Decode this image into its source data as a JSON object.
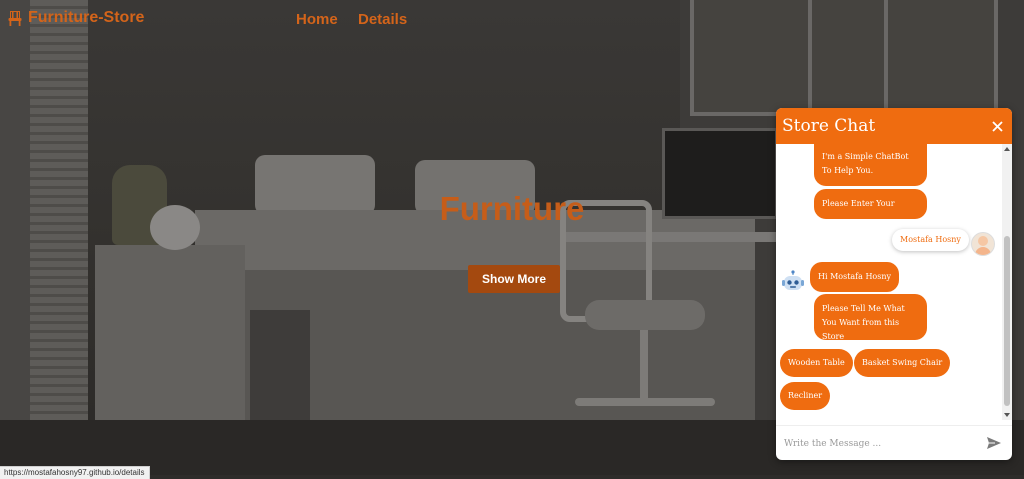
{
  "navbar": {
    "brand": "Furniture-Store",
    "links": [
      "Home",
      "Details"
    ]
  },
  "hero": {
    "title": "Furniture",
    "button": "Show More"
  },
  "status_bar": {
    "url": "https://mostafahosny97.github.io/details"
  },
  "chat": {
    "title": "Store Chat",
    "messages": {
      "bot_intro": "I'm a Simple ChatBot To Help You.",
      "bot_ask_name": "Please Enter Your Name!",
      "user_name": "Mostafa Hosny",
      "bot_greet": "Hi Mostafa Hosny",
      "bot_ask_want": "Please Tell Me What You Want from this Store"
    },
    "options": [
      "Wooden Table",
      "Basket Swing Chair",
      "Recliner"
    ],
    "input_placeholder": "Write the Message ..."
  },
  "colors": {
    "accent": "#ef6c10",
    "brand": "#d4641a",
    "hero_button": "#a4490f"
  }
}
